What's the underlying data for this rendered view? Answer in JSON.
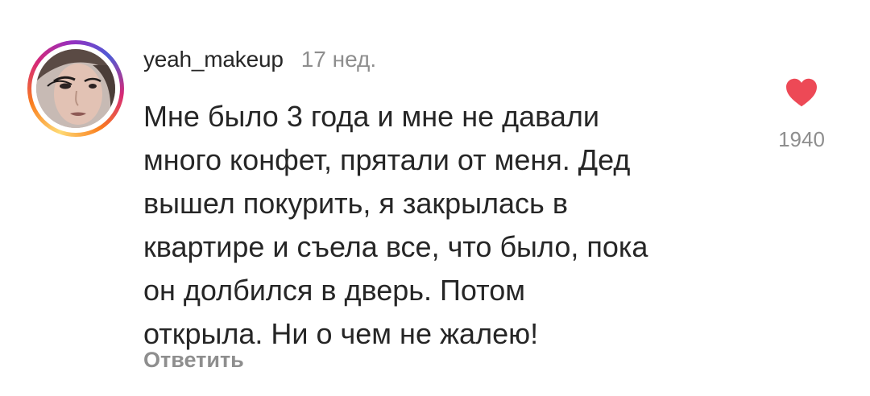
{
  "comment": {
    "username": "yeah_makeup",
    "time_ago": "17 нед.",
    "text_lines": [
      "Мне было 3 года и мне не давали",
      "много конфет, прятали от меня. Дед",
      "вышел покурить, я закрылась в",
      "квартире и съела все, что было, пока",
      "он долбился в дверь. Потом",
      "открыла. Ни о чем не жалею!"
    ],
    "reply_label": "Ответить",
    "like_count": "1940",
    "like_icon": "heart-filled-icon",
    "like_color": "#ed4956",
    "avatar_ring_story": true
  }
}
